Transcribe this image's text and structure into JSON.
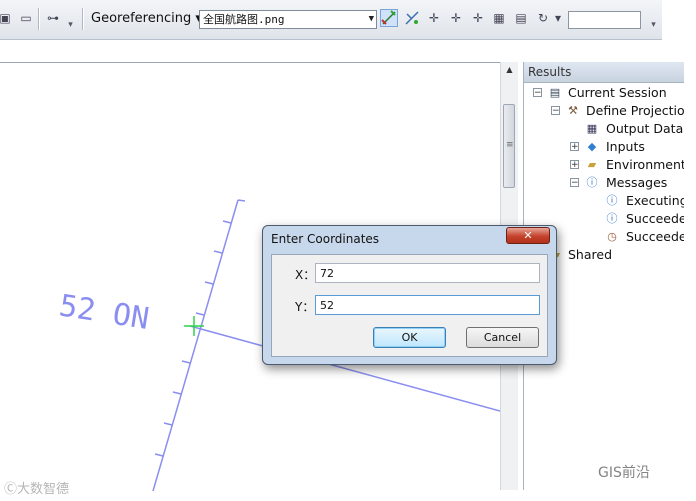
{
  "toolbar": {
    "georef_label": "Georeferencing",
    "georef_menu_arrow": "▾",
    "layer_select_value": "全国航路图.png",
    "layer_select_arrow": "▼",
    "rotate_menu_arrow": "▾",
    "scale_value": ""
  },
  "map": {
    "label_text": "52 ON"
  },
  "results": {
    "header": "Results",
    "items": [
      {
        "label": "Current Session",
        "icon": "session-icon",
        "toggle": "−"
      },
      {
        "label": "Define Projection",
        "icon": "hammer-icon",
        "toggle": "−"
      },
      {
        "label": "Output Data",
        "icon": "raster-icon",
        "toggle": ""
      },
      {
        "label": "Inputs",
        "icon": "diamond-icon",
        "toggle": "+"
      },
      {
        "label": "Environments",
        "icon": "folder-icon",
        "toggle": "+"
      },
      {
        "label": "Messages",
        "icon": "info-icon",
        "toggle": "−"
      },
      {
        "label": "Executing",
        "icon": "info-icon",
        "toggle": ""
      },
      {
        "label": "Succeeded",
        "icon": "info-icon",
        "toggle": ""
      },
      {
        "label": "Succeeded",
        "icon": "clock-icon",
        "toggle": ""
      },
      {
        "label": "Shared",
        "icon": "folder-icon",
        "toggle": ""
      }
    ]
  },
  "dialog": {
    "title": "Enter Coordinates",
    "close_glyph": "✕",
    "x_label": "X：",
    "x_value": "72",
    "y_label": "Y：",
    "y_value": "52",
    "ok_label": "OK",
    "cancel_label": "Cancel"
  },
  "watermarks": {
    "left": "Ⓒ大数智德",
    "right": "GIS前沿"
  },
  "colors": {
    "map_line": "#8a8ef0",
    "control_point": "#2fd24a"
  }
}
